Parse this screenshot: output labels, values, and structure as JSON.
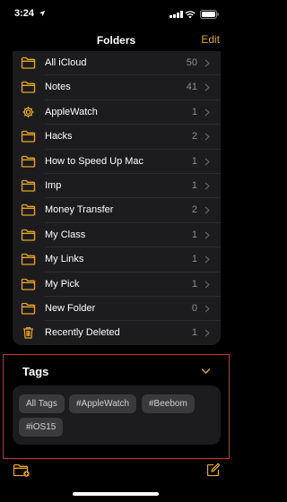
{
  "status_bar": {
    "time": "3:24"
  },
  "nav": {
    "title": "Folders",
    "edit_label": "Edit"
  },
  "folders": [
    {
      "label": "All iCloud",
      "count": "50",
      "icon": "folder-icon"
    },
    {
      "label": "Notes",
      "count": "41",
      "icon": "folder-icon"
    },
    {
      "label": "AppleWatch",
      "count": "1",
      "icon": "gear-icon"
    },
    {
      "label": "Hacks",
      "count": "2",
      "icon": "folder-icon"
    },
    {
      "label": "How to Speed Up Mac",
      "count": "1",
      "icon": "folder-icon"
    },
    {
      "label": "Imp",
      "count": "1",
      "icon": "folder-icon"
    },
    {
      "label": "Money Transfer",
      "count": "2",
      "icon": "folder-icon"
    },
    {
      "label": "My Class",
      "count": "1",
      "icon": "folder-icon"
    },
    {
      "label": "My Links",
      "count": "1",
      "icon": "folder-icon"
    },
    {
      "label": "My Pick",
      "count": "1",
      "icon": "folder-icon"
    },
    {
      "label": "New Folder",
      "count": "0",
      "icon": "folder-icon"
    },
    {
      "label": "Recently Deleted",
      "count": "1",
      "icon": "trash-icon"
    }
  ],
  "tags": {
    "title": "Tags",
    "items": [
      "All Tags",
      "#AppleWatch",
      "#Beebom",
      "#iOS15"
    ]
  },
  "colors": {
    "accent": "#e6a527",
    "background": "#000000",
    "card": "#1c1c1e",
    "chip": "#3a3a3c",
    "highlight_border": "#d0323a",
    "secondary_text": "#8e8e93"
  }
}
